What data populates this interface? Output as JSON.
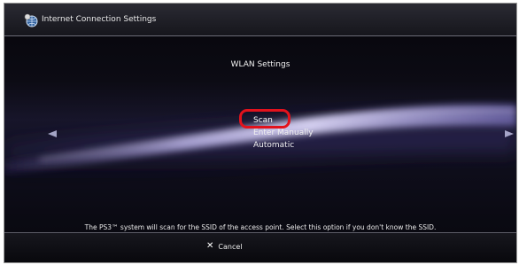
{
  "header": {
    "title": "Internet Connection Settings",
    "icon": "network-globe-icon"
  },
  "subheading": "WLAN Settings",
  "menu": {
    "items": [
      {
        "label": "Scan",
        "selected": true
      },
      {
        "label": "Enter Manually",
        "selected": false
      },
      {
        "label": "Automatic",
        "selected": false
      }
    ]
  },
  "hint": "The PS3™ system will scan for the SSID of the access point. Select this option if you don't know the SSID.",
  "footer": {
    "cancel_label": "Cancel",
    "cancel_icon": "cross-icon"
  },
  "colors": {
    "background": "#0c0b14",
    "wave": "#c9c3ee",
    "highlight_ring": "#e3121c",
    "text": "#ffffff"
  }
}
